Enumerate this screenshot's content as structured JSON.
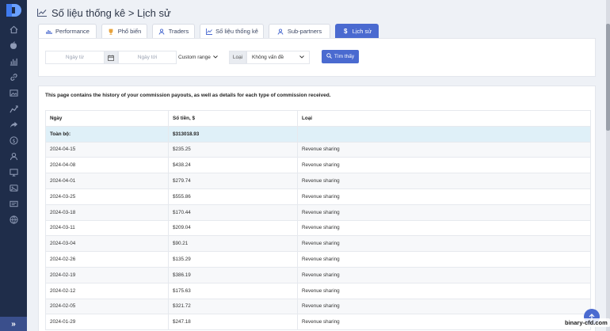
{
  "header": {
    "title": "Số liệu thống kê > Lịch sử"
  },
  "tabs": [
    {
      "label": "Performance",
      "icon": "bar-chart-icon"
    },
    {
      "label": "Phổ biến",
      "icon": "trophy-icon"
    },
    {
      "label": "Traders",
      "icon": "user-icon"
    },
    {
      "label": "Số liệu thống kê",
      "icon": "line-chart-icon"
    },
    {
      "label": "Sub-partners",
      "icon": "user-icon"
    },
    {
      "label": "Lịch sử",
      "icon": "dollar-icon",
      "active": true
    }
  ],
  "filters": {
    "date_from_placeholder": "Ngày từ",
    "date_to_placeholder": "Ngày tới",
    "range_value": "Custom range",
    "type_label": "Loại",
    "type_value": "Không vấn đề",
    "find_label": "Tìm thấy"
  },
  "info_text": "This page contains the history of your commission payouts, as well as details for each type of commission received.",
  "table": {
    "headers": [
      "Ngày",
      "Số tiền, $",
      "Loại"
    ],
    "total": {
      "label": "Toàn bộ:",
      "amount": "$313018.93",
      "type": ""
    },
    "rows": [
      {
        "date": "2024-04-15",
        "amount": "$235.25",
        "type": "Revenue sharing"
      },
      {
        "date": "2024-04-08",
        "amount": "$438.24",
        "type": "Revenue sharing"
      },
      {
        "date": "2024-04-01",
        "amount": "$279.74",
        "type": "Revenue sharing"
      },
      {
        "date": "2024-03-25",
        "amount": "$555.86",
        "type": "Revenue sharing"
      },
      {
        "date": "2024-03-18",
        "amount": "$170.44",
        "type": "Revenue sharing"
      },
      {
        "date": "2024-03-11",
        "amount": "$209.04",
        "type": "Revenue sharing"
      },
      {
        "date": "2024-03-04",
        "amount": "$90.21",
        "type": "Revenue sharing"
      },
      {
        "date": "2024-02-26",
        "amount": "$135.29",
        "type": "Revenue sharing"
      },
      {
        "date": "2024-02-19",
        "amount": "$386.19",
        "type": "Revenue sharing"
      },
      {
        "date": "2024-02-12",
        "amount": "$175.63",
        "type": "Revenue sharing"
      },
      {
        "date": "2024-02-05",
        "amount": "$321.72",
        "type": "Revenue sharing"
      },
      {
        "date": "2024-01-29",
        "amount": "$247.18",
        "type": "Revenue sharing"
      }
    ]
  },
  "sidebar": {
    "icons": [
      "home-icon",
      "apple-icon",
      "bar-chart-icon",
      "link-icon",
      "image-icon",
      "briefcase-icon",
      "trend-icon",
      "share-icon",
      "dollar-icon",
      "user-icon",
      "monitor-icon",
      "photo-icon",
      "id-card-icon",
      "globe-icon"
    ],
    "expand_label": "»"
  },
  "watermark": "binary-cfd.com",
  "colors": {
    "accent": "#4a6ad0",
    "sidebar": "#1f2d4a",
    "total_row": "#dff0f8"
  }
}
